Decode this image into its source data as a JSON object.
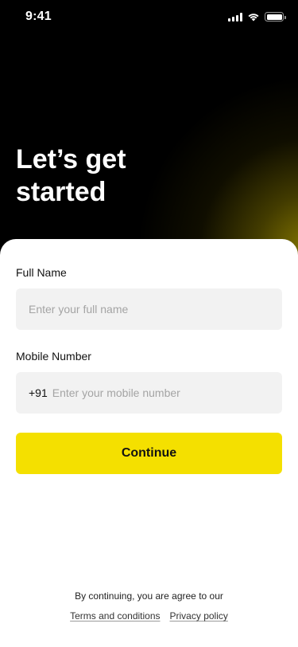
{
  "status_bar": {
    "time": "9:41",
    "icons": [
      "cellular-signal-icon",
      "wifi-icon",
      "battery-icon"
    ]
  },
  "hero": {
    "title": "Let’s get\nstarted"
  },
  "form": {
    "full_name": {
      "label": "Full Name",
      "placeholder": "Enter your full name",
      "value": ""
    },
    "mobile": {
      "label": "Mobile Number",
      "country_code": "+91",
      "placeholder": "Enter your mobile number",
      "value": ""
    },
    "continue_label": "Continue"
  },
  "footer": {
    "consent_text": "By continuing, you are agree to our",
    "terms_label": "Terms and conditions",
    "privacy_label": "Privacy policy"
  },
  "colors": {
    "accent": "#f4e000",
    "background": "#000000",
    "sheet": "#ffffff",
    "input_bg": "#f2f2f2"
  }
}
